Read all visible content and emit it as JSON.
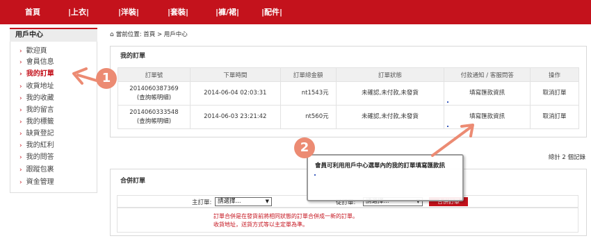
{
  "nav": {
    "items": [
      "首頁",
      "|上衣|",
      "|洋裝|",
      "|套裝|",
      "|褲/裙|",
      "|配件|"
    ]
  },
  "sidebar": {
    "title": "用戶中心",
    "items": [
      "歡迎頁",
      "會員信息",
      "我的訂單",
      "收貨地址",
      "我的收藏",
      "我的留言",
      "我的標籤",
      "缺貨登記",
      "我的紅利",
      "我的問答",
      "跟蹤包裹",
      "資金管理"
    ],
    "active_index": 2
  },
  "breadcrumb": "當前位置: 首頁 > 用戶中心",
  "orders": {
    "title": "我的訂單",
    "columns": [
      "訂單號",
      "下單時間",
      "訂單總金額",
      "訂單狀態",
      "付款通知 / 客服問答",
      "操作"
    ],
    "rows": [
      {
        "order_no": "2014060387369",
        "detail": "(查詢帳明細)",
        "time": "2014-06-04 02:03:31",
        "amount": "nt1543元",
        "status": "未確認,未付款,未發貨",
        "notice": "填寫匯款資訊",
        "action": "取消訂單"
      },
      {
        "order_no": "2014060333548",
        "detail": "(查詢帳明細)",
        "time": "2014-06-03 23:21:42",
        "amount": "nt560元",
        "status": "未確認,未付款,未發貨",
        "notice": "填寫匯款資訊",
        "action": "取消訂單"
      }
    ],
    "total": "總計 2 個記錄"
  },
  "merge": {
    "title": "合併訂單",
    "main_label": "主訂單:",
    "main_select": "請選擇...",
    "sub_label": "從訂單:",
    "sub_select": "請選擇...",
    "button": "合併訂單",
    "note_line1": "訂單合併是在發貨前將相同狀態的訂單合併成一新的訂單。",
    "note_line2": "收貨地址，送貨方式等以主定單為準。"
  },
  "callouts": {
    "badge1": "1",
    "badge2": "2",
    "text": "會員可利用用戶中心選單內的我的訂單填寫匯款訊",
    "accent": "#ec8b73"
  },
  "colors": {
    "brand": "#c4121c"
  }
}
